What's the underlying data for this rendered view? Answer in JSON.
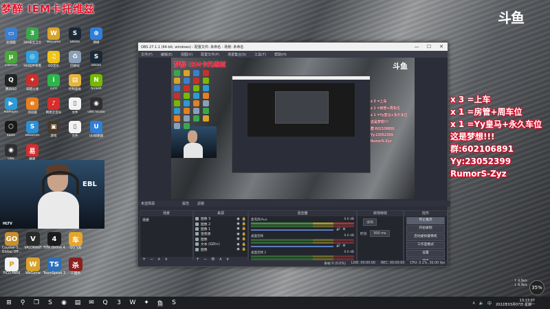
{
  "overlay": {
    "title": "梦醉 IEM卡托维兹",
    "logo": "斗鱼"
  },
  "desktop_icons_top": [
    {
      "label": "此电脑",
      "icon": "computer-icon",
      "color": "#3b7fd0",
      "glyph": "▭"
    },
    {
      "label": "360安全卫士",
      "icon": "shield-icon",
      "color": "#3aa84a",
      "glyph": "3"
    },
    {
      "label": "WeGame",
      "icon": "wegame-icon",
      "color": "#d8a32a",
      "glyph": "W"
    },
    {
      "label": "Steam",
      "icon": "steam-icon",
      "color": "#1b2838",
      "glyph": "S"
    },
    {
      "label": "网络",
      "icon": "network-icon",
      "color": "#2f7fd8",
      "glyph": "⊕"
    },
    {
      "label": "uTorrent",
      "icon": "utorrent-icon",
      "color": "#4aa838",
      "glyph": "µ"
    },
    {
      "label": "360软件管家",
      "icon": "software-manager-icon",
      "color": "#2fa0e0",
      "glyph": "◎"
    },
    {
      "label": "QQ音乐",
      "icon": "qq-music-icon",
      "color": "#f0c419",
      "glyph": "♫"
    },
    {
      "label": "回收站",
      "icon": "recycle-bin-icon",
      "color": "#8aa0b8",
      "glyph": "♻"
    },
    {
      "label": "Steam",
      "icon": "steam-icon",
      "color": "#1b2838",
      "glyph": "S"
    },
    {
      "label": "腾讯QQ",
      "icon": "qq-icon",
      "color": "#222222",
      "glyph": "Q"
    },
    {
      "label": "穿越火线",
      "icon": "cf-icon",
      "color": "#c9302c",
      "glyph": "✦"
    },
    {
      "label": "iQIYI",
      "icon": "iqiyi-icon",
      "color": "#2cb64a",
      "glyph": "i"
    },
    {
      "label": "控制面板",
      "icon": "folder-icon",
      "color": "#e6b43c",
      "glyph": "▤"
    },
    {
      "label": "NVIDIA",
      "icon": "nvidia-icon",
      "color": "#76b900",
      "glyph": "N"
    },
    {
      "label": "PotPlayer",
      "icon": "player-icon",
      "color": "#2c9ad6",
      "glyph": "▶"
    },
    {
      "label": "浏览器",
      "icon": "browser-icon",
      "color": "#e67e22",
      "glyph": "e"
    },
    {
      "label": "网易云音乐",
      "icon": "music-icon",
      "color": "#d62d2d",
      "glyph": "♪"
    },
    {
      "label": "文件",
      "icon": "file-icon",
      "color": "#f2f2f2",
      "glyph": "▯"
    },
    {
      "label": "OBS Studio",
      "icon": "obs-icon",
      "color": "#302e31",
      "glyph": "◉"
    },
    {
      "label": "Razer",
      "icon": "razer-icon",
      "color": "#1a1a1a",
      "glyph": "⬡"
    },
    {
      "label": "SteamVR",
      "icon": "steamvr-icon",
      "color": "#2c8fd6",
      "glyph": "S"
    },
    {
      "label": "游戏",
      "icon": "game-icon",
      "color": "#4a3a2a",
      "glyph": "▣"
    },
    {
      "label": "文件",
      "icon": "file-icon",
      "color": "#f2f2f2",
      "glyph": "▯"
    },
    {
      "label": "UU加速器",
      "icon": "uu-icon",
      "color": "#2f7fd8",
      "glyph": "U"
    },
    {
      "label": "OBS",
      "icon": "obs-icon",
      "color": "#302e31",
      "glyph": "◉"
    },
    {
      "label": "网易",
      "icon": "netease-icon",
      "color": "#d62d2d",
      "glyph": "易"
    }
  ],
  "rank_overlay": [
    {
      "icon": "gold-bar-icon",
      "color": "#e0b24a",
      "glyph": "▰",
      "text": "x 3 =上车"
    },
    {
      "icon": "rocket-icon",
      "color": "#c23a3a",
      "glyph": "➶",
      "text": "x 1 =房管+周车位"
    },
    {
      "icon": "rocket-icon",
      "color": "#b2302f",
      "glyph": "➶",
      "text": "x 1 =Yy皇马+永久车位"
    },
    {
      "icon": "lion-icon",
      "color": "#c6962f",
      "glyph": "♛",
      "text": "这是梦想!!!"
    },
    {
      "icon": "lion-icon",
      "color": "#b88a2a",
      "glyph": "♛",
      "text": "群:602106891"
    },
    {
      "icon": "lion-icon",
      "color": "#a87a2a",
      "glyph": "♛",
      "text": "Yy:23052399"
    },
    {
      "icon": "weibo-icon",
      "color": "#e6162d",
      "glyph": "◉",
      "text": "RumorS-Zyz"
    }
  ],
  "obs": {
    "title": "OBS 27.1.1 (64-bit, windows) - 配置文件: 未命名 - 场景: 未命名",
    "menu": [
      "文件(F)",
      "编辑(E)",
      "视图(V)",
      "配置文件(P)",
      "场景集合(S)",
      "工具(T)",
      "帮助(H)"
    ],
    "scene_bar": "未选择源",
    "props_label": "属性",
    "filters_label": "滤镜",
    "panels": {
      "scenes": "场景",
      "sources": "来源",
      "mixer": "混音器",
      "transitions": "转场特效",
      "controls": "控件"
    },
    "scenes": [
      "场景"
    ],
    "sources": [
      "图像 3",
      "图像 2",
      "图像 1",
      "音频源",
      "图像",
      "文本 (GDI+)",
      "图像"
    ],
    "mixer": [
      {
        "name": "麦克风/Aux",
        "db": "0.0 dB"
      },
      {
        "name": "桌面音频",
        "db": "0.0 dB"
      },
      {
        "name": "桌面音频 2",
        "db": "0.0 dB"
      }
    ],
    "transition": {
      "type": "淡出",
      "duration_label": "时长",
      "duration": "300 ms"
    },
    "controls": [
      "停止推流",
      "开始录制",
      "启动虚拟摄像机",
      "工作室模式",
      "设置",
      "退出"
    ],
    "status": {
      "drop": "丢帧 0 (0.0%)",
      "live": "LIVE: 00:00:00",
      "rec": "REC: 00:00:00",
      "cpu": "CPU: 0.1%, 30.00 fps"
    },
    "preview_ranks": [
      "x 3 =上车",
      "x 1 =房管+周车位",
      "x 1 =Yy皇马+永久车位",
      "这是梦想!!!",
      "群:602106891",
      "Yy:23052399",
      "RumorS-Zyz"
    ],
    "preview_title": "梦醉 IEM卡托维兹",
    "preview_logo": "斗鱼"
  },
  "webcam": {
    "brand": "EBL",
    "tag": "HLTV"
  },
  "desktop_icons_bottom": [
    {
      "label": "Counter-S... Global Off...",
      "icon": "csgo-icon",
      "color": "#c98f2a",
      "glyph": "GO"
    },
    {
      "label": "VALORANT",
      "icon": "valorant-icon",
      "color": "#2a2a2a",
      "glyph": "V"
    },
    {
      "label": "FIFA Online 4",
      "icon": "fifa-icon",
      "color": "#1c1c1c",
      "glyph": "4"
    },
    {
      "label": "QQ飞车",
      "icon": "qq-speed-icon",
      "color": "#e6a62a",
      "glyph": "车"
    },
    {
      "label": "PICO PARK",
      "icon": "pico-icon",
      "color": "#f2f2f2",
      "glyph": "P"
    },
    {
      "label": "WeGame",
      "icon": "wegame-icon",
      "color": "#d8a32a",
      "glyph": "W"
    },
    {
      "label": "TeamSpeak 3",
      "icon": "teamspeak-icon",
      "color": "#2c6fb6",
      "glyph": "TS"
    },
    {
      "label": "三国杀",
      "icon": "sanguosha-icon",
      "color": "#8a1f1f",
      "glyph": "杀"
    }
  ],
  "network": {
    "up": "↑ 4.5k/s",
    "down": "↓ 6.3k/s",
    "percent": "35%"
  },
  "taskbar": {
    "items": [
      {
        "icon": "windows-start-icon",
        "glyph": "⊞"
      },
      {
        "icon": "search-icon",
        "glyph": "⚲"
      },
      {
        "icon": "task-view-icon",
        "glyph": "❐"
      },
      {
        "icon": "steam-icon",
        "glyph": "S"
      },
      {
        "icon": "obs-icon",
        "glyph": "◉"
      },
      {
        "icon": "file-explorer-icon",
        "glyph": "▤"
      },
      {
        "icon": "wechat-icon",
        "glyph": "✉"
      },
      {
        "icon": "qq-icon",
        "glyph": "Q"
      },
      {
        "icon": "360-icon",
        "glyph": "3"
      },
      {
        "icon": "wegame-icon",
        "glyph": "W"
      },
      {
        "icon": "csgo-icon",
        "glyph": "✦"
      },
      {
        "icon": "douyu-icon",
        "glyph": "鱼"
      },
      {
        "icon": "steam-icon",
        "glyph": "S"
      }
    ],
    "time": "13:13:07",
    "date": "2022年03月07日 星期一",
    "lang": "中"
  }
}
